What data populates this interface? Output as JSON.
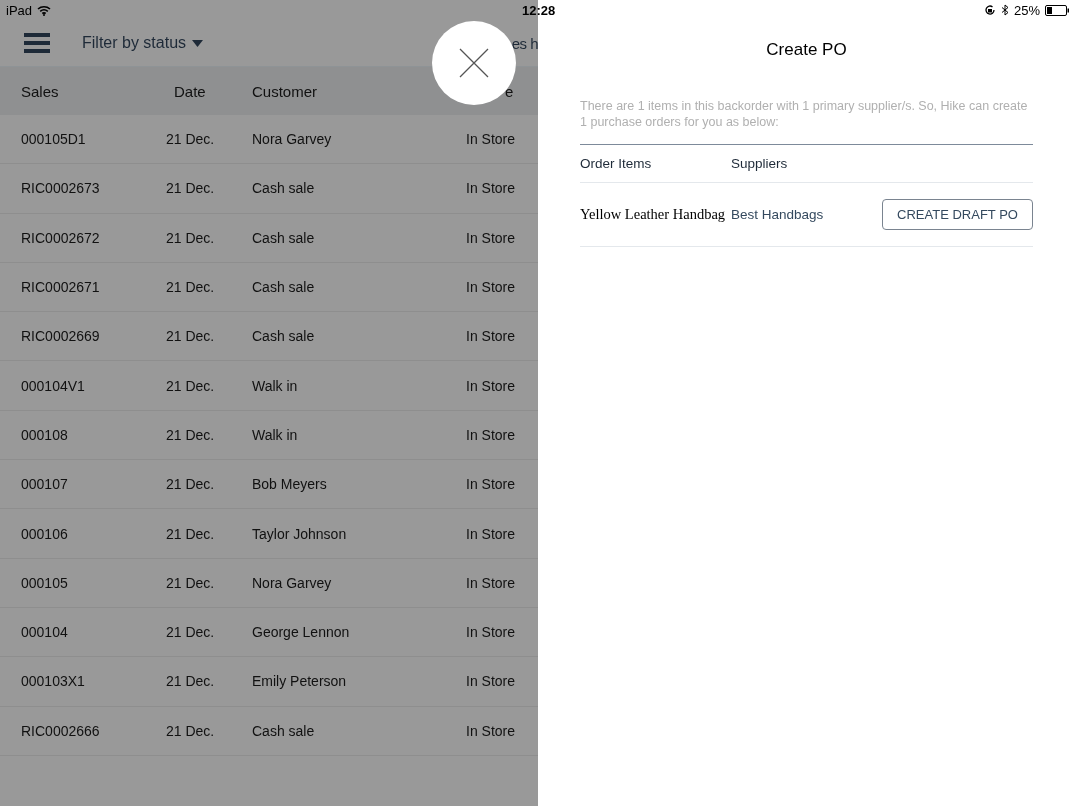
{
  "status_bar": {
    "device": "iPad",
    "time": "12:28",
    "battery": "25%"
  },
  "toolbar": {
    "filter": "Filter by status",
    "title_fragment": "es h"
  },
  "table": {
    "columns": [
      "Sales",
      "Date",
      "Customer",
      "e"
    ],
    "rows": [
      [
        "000105D1",
        "21 Dec.",
        "Nora Garvey",
        "In Store"
      ],
      [
        "RIC0002673",
        "21 Dec.",
        "Cash sale",
        "In Store"
      ],
      [
        "RIC0002672",
        "21 Dec.",
        "Cash sale",
        "In Store"
      ],
      [
        "RIC0002671",
        "21 Dec.",
        "Cash sale",
        "In Store"
      ],
      [
        "RIC0002669",
        "21 Dec.",
        "Cash sale",
        "In Store"
      ],
      [
        "000104V1",
        "21 Dec.",
        "Walk in",
        "In Store"
      ],
      [
        "000108",
        "21 Dec.",
        "Walk in",
        "In Store"
      ],
      [
        "000107",
        "21 Dec.",
        "Bob Meyers",
        "In Store"
      ],
      [
        "000106",
        "21 Dec.",
        "Taylor Johnson",
        "In Store"
      ],
      [
        "000105",
        "21 Dec.",
        "Nora Garvey",
        "In Store"
      ],
      [
        "000104",
        "21 Dec.",
        "George Lennon",
        "In Store"
      ],
      [
        "000103X1",
        "21 Dec.",
        "Emily Peterson",
        "In Store"
      ],
      [
        "RIC0002666",
        "21 Dec.",
        "Cash sale",
        "In Store"
      ]
    ]
  },
  "panel": {
    "title": "Create PO",
    "message": "There are 1 items in this backorder with 1 primary supplier/s. So, Hike can create 1 purchase orders for you as below:",
    "columns": [
      "Order Items",
      "Suppliers"
    ],
    "items": [
      {
        "item": "Yellow Leather Handbag",
        "supplier": "Best Handbags",
        "action": "CREATE DRAFT PO"
      }
    ]
  }
}
